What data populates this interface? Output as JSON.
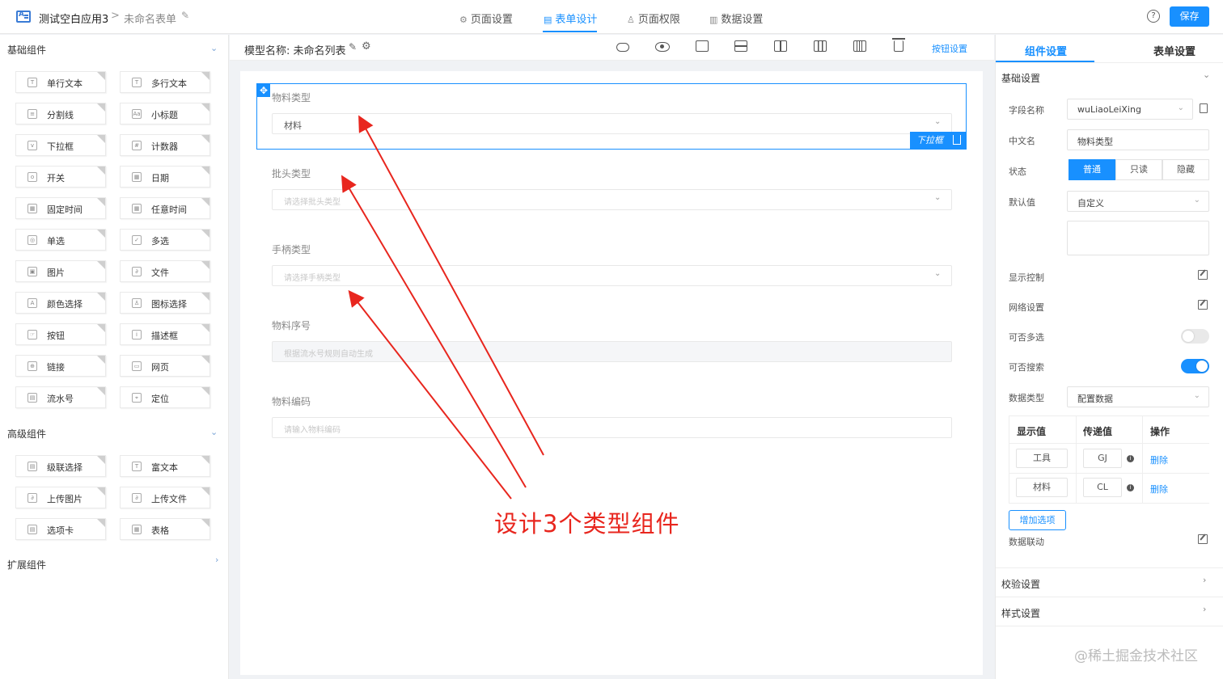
{
  "header": {
    "app_name": "测试空白应用3",
    "breadcrumb_sep": ">",
    "form_name": "未命名表单",
    "tabs": [
      {
        "label": "页面设置",
        "icon": "gear-icon"
      },
      {
        "label": "表单设计",
        "icon": "document-icon"
      },
      {
        "label": "页面权限",
        "icon": "user-icon"
      },
      {
        "label": "数据设置",
        "icon": "bar-chart-icon"
      }
    ],
    "active_tab": "表单设计",
    "help": "?",
    "save_label": "保存"
  },
  "left_panel": {
    "basic_title": "基础组件",
    "basic_items": [
      {
        "label": "单行文本",
        "icon": "T"
      },
      {
        "label": "多行文本",
        "icon": "T"
      },
      {
        "label": "分割线",
        "icon": "≡"
      },
      {
        "label": "小标题",
        "icon": "Aa"
      },
      {
        "label": "下拉框",
        "icon": "v"
      },
      {
        "label": "计数器",
        "icon": "#"
      },
      {
        "label": "开关",
        "icon": "o"
      },
      {
        "label": "日期",
        "icon": "▦"
      },
      {
        "label": "固定时间",
        "icon": "▦"
      },
      {
        "label": "任意时间",
        "icon": "▦"
      },
      {
        "label": "单选",
        "icon": "◎"
      },
      {
        "label": "多选",
        "icon": "✓"
      },
      {
        "label": "图片",
        "icon": "▣"
      },
      {
        "label": "文件",
        "icon": "∂"
      },
      {
        "label": "颜色选择",
        "icon": "A"
      },
      {
        "label": "图标选择",
        "icon": "♙"
      },
      {
        "label": "按钮",
        "icon": "☞"
      },
      {
        "label": "描述框",
        "icon": "i"
      },
      {
        "label": "链接",
        "icon": "⊕"
      },
      {
        "label": "网页",
        "icon": "▭"
      },
      {
        "label": "流水号",
        "icon": "▤"
      },
      {
        "label": "定位",
        "icon": "⌖"
      }
    ],
    "advanced_title": "高级组件",
    "advanced_items": [
      {
        "label": "级联选择",
        "icon": "▤"
      },
      {
        "label": "富文本",
        "icon": "T"
      },
      {
        "label": "上传图片",
        "icon": "∂"
      },
      {
        "label": "上传文件",
        "icon": "∂"
      },
      {
        "label": "选项卡",
        "icon": "▤"
      },
      {
        "label": "表格",
        "icon": "▦"
      }
    ],
    "extension_title": "扩展组件"
  },
  "center": {
    "model_label": "模型名称: 未命名列表",
    "toolbar_button": "按钮设置",
    "selected_tag": "下拉框",
    "fields": [
      {
        "label": "物料类型",
        "value": "材料",
        "placeholder": "",
        "type": "select"
      },
      {
        "label": "批头类型",
        "value": "",
        "placeholder": "请选择批头类型",
        "type": "select"
      },
      {
        "label": "手柄类型",
        "value": "",
        "placeholder": "请选择手柄类型",
        "type": "select"
      },
      {
        "label": "物料序号",
        "value": "",
        "placeholder": "根据流水号规则自动生成",
        "type": "serial"
      },
      {
        "label": "物料编码",
        "value": "",
        "placeholder": "请输入物料编码",
        "type": "text"
      }
    ],
    "annotation": "设计3个类型组件",
    "annotation_color": "#e8261e"
  },
  "right_panel": {
    "tabs": [
      "组件设置",
      "表单设置"
    ],
    "active_tab": "组件设置",
    "basic_section": "基础设置",
    "field_name_label": "字段名称",
    "field_name_value": "wuLiaoLeiXing",
    "cn_name_label": "中文名",
    "cn_name_value": "物料类型",
    "status_label": "状态",
    "status_options": [
      "普通",
      "只读",
      "隐藏"
    ],
    "status_selected": "普通",
    "default_label": "默认值",
    "default_value": "自定义",
    "display_control_label": "显示控制",
    "grid_label": "网络设置",
    "multi_label": "可否多选",
    "multi_on": false,
    "search_label": "可否搜索",
    "search_on": true,
    "data_type_label": "数据类型",
    "data_type_value": "配置数据",
    "options_headers": [
      "显示值",
      "传递值",
      "操作"
    ],
    "options": [
      {
        "display": "工具",
        "value": "GJ",
        "action": "删除"
      },
      {
        "display": "材料",
        "value": "CL",
        "action": "删除"
      }
    ],
    "add_option_label": "增加选项",
    "linkage_label": "数据联动",
    "validation_section": "校验设置",
    "style_section": "样式设置"
  },
  "watermark": "@稀土掘金技术社区",
  "accent_color": "#1890ff"
}
